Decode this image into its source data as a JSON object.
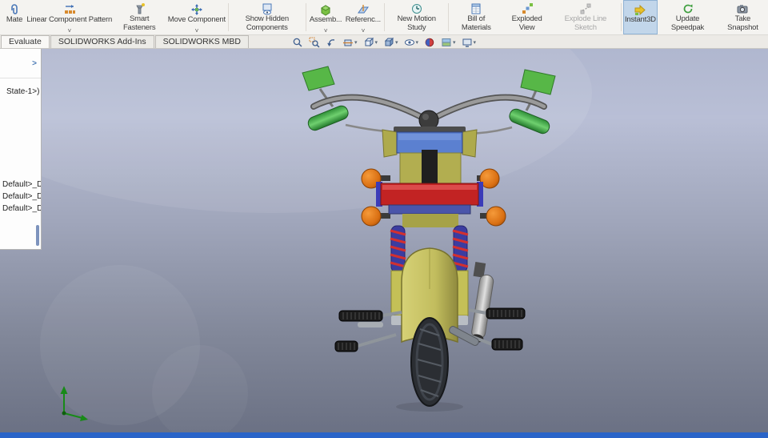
{
  "toolbar": {
    "buttons": [
      {
        "label": "Mate",
        "dropdown": false,
        "state": "normal"
      },
      {
        "label": "Linear Component Pattern",
        "dropdown": true,
        "state": "normal"
      },
      {
        "label": "Smart Fasteners",
        "dropdown": false,
        "state": "normal"
      },
      {
        "label": "Move Component",
        "dropdown": true,
        "state": "normal"
      },
      {
        "label": "Show Hidden Components",
        "dropdown": false,
        "state": "normal"
      },
      {
        "label": "Assemb...",
        "dropdown": true,
        "state": "normal"
      },
      {
        "label": "Referenc...",
        "dropdown": true,
        "state": "normal"
      },
      {
        "label": "New Motion Study",
        "dropdown": false,
        "state": "normal"
      },
      {
        "label": "Bill of Materials",
        "dropdown": false,
        "state": "normal"
      },
      {
        "label": "Exploded View",
        "dropdown": false,
        "state": "normal"
      },
      {
        "label": "Explode Line Sketch",
        "dropdown": false,
        "state": "disabled"
      },
      {
        "label": "Instant3D",
        "dropdown": false,
        "state": "active"
      },
      {
        "label": "Update Speedpak",
        "dropdown": false,
        "state": "normal"
      },
      {
        "label": "Take Snapshot",
        "dropdown": false,
        "state": "normal"
      }
    ]
  },
  "tabs": [
    {
      "label": "Evaluate",
      "active": true
    },
    {
      "label": "SOLIDWORKS Add-Ins",
      "active": false
    },
    {
      "label": "SOLIDWORKS MBD",
      "active": false
    }
  ],
  "feature_tree": {
    "items": [
      "State-1>)",
      "Default>_Dis",
      "Default>_Di",
      "Default>_Di"
    ]
  },
  "hud": {
    "icons": [
      {
        "name": "zoom-to-fit",
        "dropdown": false
      },
      {
        "name": "zoom-to-area",
        "dropdown": false
      },
      {
        "name": "previous-view",
        "dropdown": false
      },
      {
        "name": "section-view",
        "dropdown": true
      },
      {
        "name": "view-orientation",
        "dropdown": true
      },
      {
        "name": "display-style",
        "dropdown": true
      },
      {
        "name": "hide-show-items",
        "dropdown": true
      },
      {
        "name": "edit-appearance",
        "dropdown": false
      },
      {
        "name": "apply-scene",
        "dropdown": true
      },
      {
        "name": "view-settings",
        "dropdown": true
      }
    ]
  },
  "viewport": {
    "gradient_top": "#b2b9d1",
    "gradient_bottom": "#6b7184",
    "model_colors": {
      "fender_yellow": "#c8c35e",
      "frame_red": "#c22323",
      "signal_orange": "#e07818",
      "grip_green": "#3fae4a",
      "mirror_green": "#57b747",
      "plate_blue": "#5b80d0",
      "spring_blue": "#3c3ca0",
      "tire_gray": "#2b2e33",
      "exhaust_silver": "#c0c0c0",
      "triad_green": "#188a18"
    }
  },
  "status_bar": {
    "color": "#2a64c8",
    "text": ""
  }
}
